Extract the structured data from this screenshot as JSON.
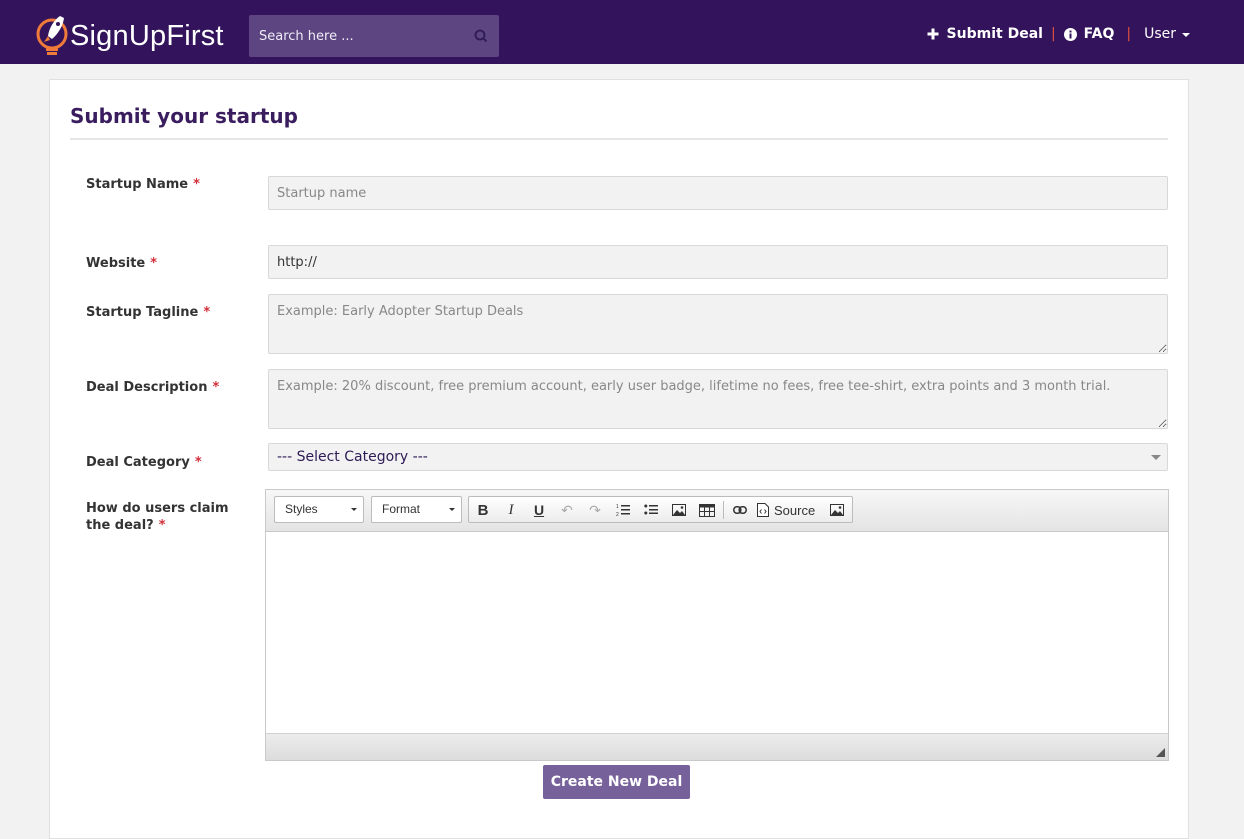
{
  "navbar": {
    "brand": "SignUpFirst",
    "search_placeholder": "Search here ...",
    "links": {
      "submit_deal": "Submit Deal",
      "faq": "FAQ",
      "user": "User"
    },
    "separator": "|",
    "colors": {
      "bg": "#33145c",
      "search_bg": "#5c4580",
      "separator": "#e1503c"
    }
  },
  "form": {
    "title": "Submit your startup",
    "required_mark": "*",
    "fields": {
      "startup_name": {
        "label": "Startup Name",
        "placeholder": "Startup name",
        "value": ""
      },
      "website": {
        "label": "Website",
        "value": "http://"
      },
      "tagline": {
        "label": "Startup Tagline",
        "placeholder": "Example: Early Adopter Startup Deals"
      },
      "description": {
        "label": "Deal Description",
        "placeholder": "Example: 20% discount, free premium account, early user badge, lifetime no fees, free tee-shirt, extra points and 3 month trial."
      },
      "category": {
        "label": "Deal Category",
        "selected": "--- Select Category ---"
      },
      "claim": {
        "label_line1": "How do users claim",
        "label_line2": "the deal?"
      }
    },
    "editor": {
      "styles_label": "Styles",
      "format_label": "Format",
      "source_label": "Source",
      "buttons": [
        "bold-icon",
        "italic-icon",
        "underline-icon",
        "undo-icon",
        "redo-icon",
        "numbered-list-icon",
        "bulleted-list-icon",
        "image-icon",
        "table-icon",
        "link-icon",
        "source-icon",
        "image2-icon"
      ]
    },
    "submit_label": "Create New Deal",
    "colors": {
      "title": "#3a1d5e",
      "required": "#d22f3b",
      "button": "#76619a"
    }
  }
}
